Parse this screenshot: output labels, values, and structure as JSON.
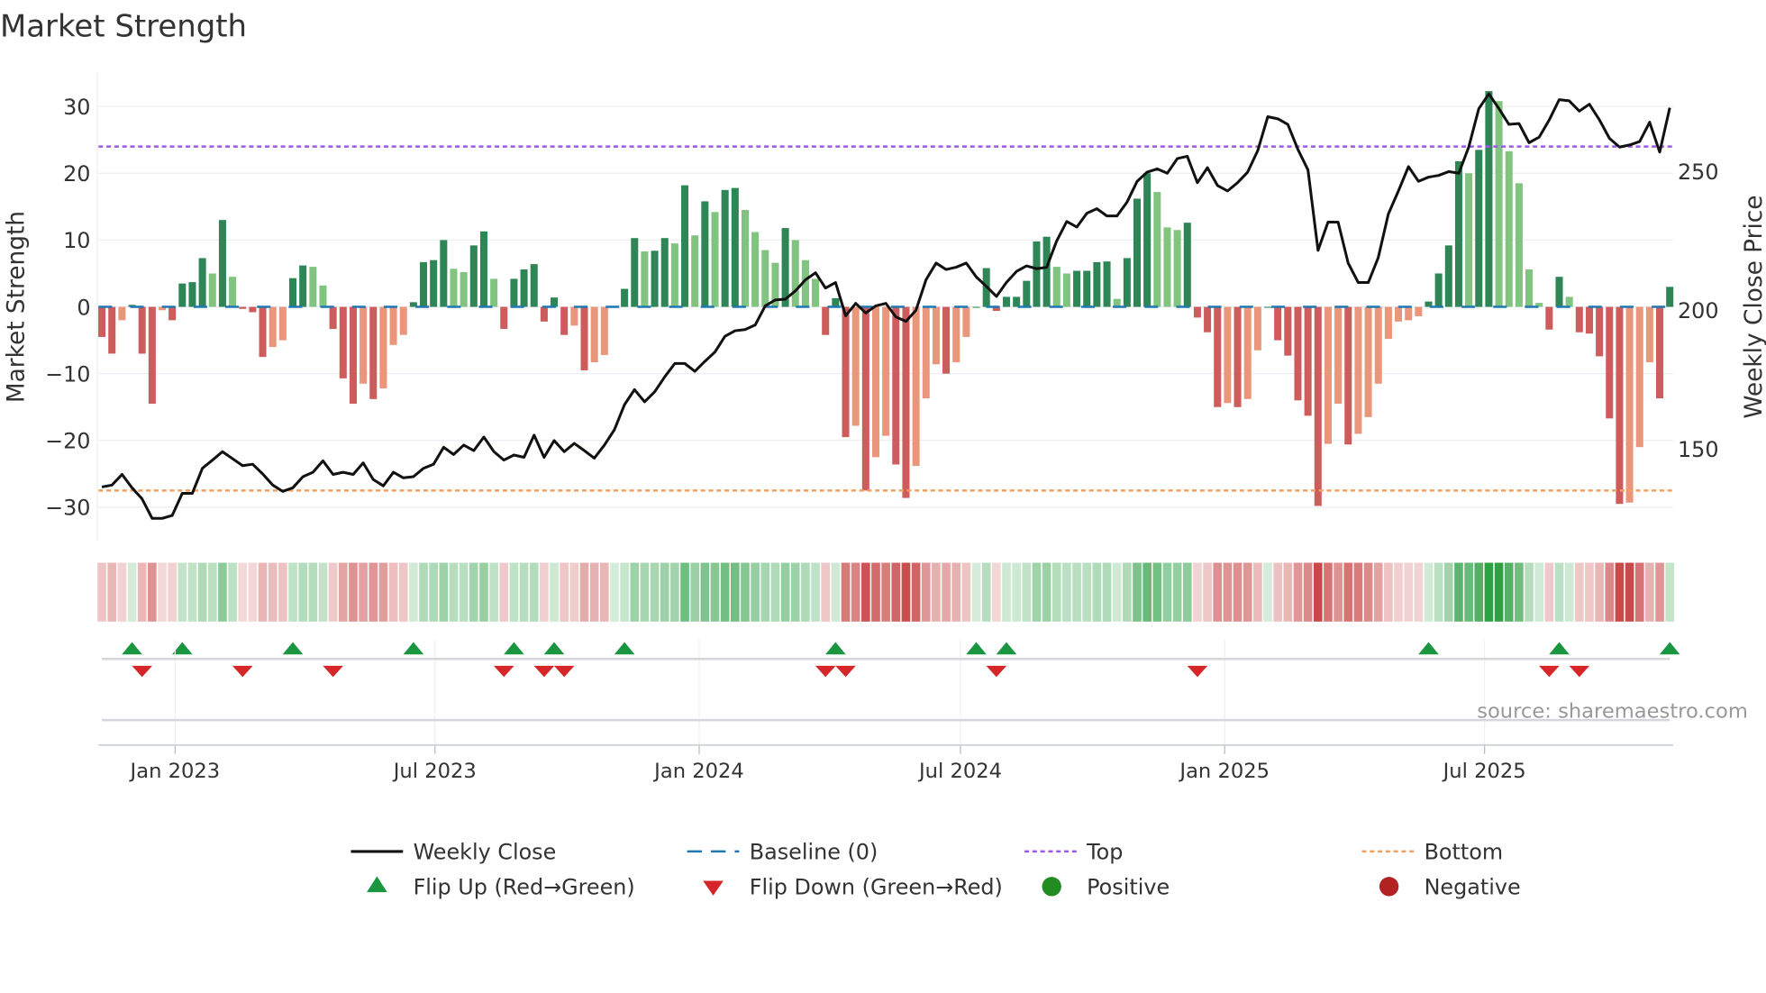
{
  "title": "Market Strength",
  "source": "source: sharemaestro.com",
  "chart_data": {
    "type": "bar",
    "title": "Market Strength",
    "ylabel": "Market Strength",
    "y2label": "Weekly Close Price",
    "ylim": [
      -35,
      35
    ],
    "y2lim": [
      116,
      289
    ],
    "yticks": [
      30,
      20,
      10,
      0,
      -10,
      -20,
      -30
    ],
    "ytick_labels": [
      "30",
      "20",
      "10",
      "0",
      "−10",
      "−20",
      "−30"
    ],
    "y2ticks": [
      250,
      200,
      150
    ],
    "y2tick_labels": [
      "250",
      "200",
      "150"
    ],
    "x_start": "2022-11-11",
    "x_step_days": 7,
    "xticks": [
      "2023-01-01",
      "2023-07-01",
      "2024-01-01",
      "2024-07-01",
      "2025-01-01",
      "2025-07-01"
    ],
    "xtick_labels": [
      "Jan 2023",
      "Jul 2023",
      "Jan 2024",
      "Jul 2024",
      "Jan 2025",
      "Jul 2025"
    ],
    "top_level": 24,
    "bottom_level": -27.5,
    "baseline": 0,
    "strength": [
      -4.5,
      -7,
      -2,
      0.3,
      -7,
      -14.5,
      -0.5,
      -2,
      3.5,
      3.7,
      7.3,
      5,
      13,
      4.5,
      -0.3,
      -0.8,
      -7.5,
      -6,
      -5,
      4.3,
      6.2,
      6,
      3.2,
      -3.3,
      -10.7,
      -14.5,
      -11.5,
      -13.8,
      -12.2,
      -5.7,
      -4.2,
      0.7,
      6.7,
      7,
      10,
      5.7,
      5.2,
      9.2,
      11.3,
      4.2,
      -3.3,
      4.2,
      5.6,
      6.4,
      -2.2,
      1.4,
      -4.2,
      -2.8,
      -9.5,
      -8.3,
      -7.2,
      0,
      2.7,
      10.3,
      8.3,
      8.4,
      10.3,
      9.5,
      18.2,
      10.7,
      15.8,
      14.2,
      17.5,
      17.8,
      14.5,
      11.2,
      8.5,
      6.6,
      11.8,
      10,
      7,
      4.2,
      -4.2,
      1.3,
      -19.5,
      -17.8,
      -27.5,
      -22.5,
      -19.3,
      -23.6,
      -28.6,
      -23.8,
      -13.7,
      -8.6,
      -10,
      -8.3,
      -4.5,
      0,
      5.8,
      -0.6,
      1.5,
      1.5,
      3.9,
      9.8,
      10.5,
      6,
      5,
      5.4,
      5.4,
      6.7,
      6.8,
      1.2,
      7.3,
      16.2,
      20,
      17.2,
      11.9,
      11.5,
      12.6,
      -1.6,
      -3.8,
      -15,
      -14.4,
      -15,
      -13.8,
      -6.5,
      0,
      -5,
      -7.3,
      -14,
      -16.3,
      -29.8,
      -20.5,
      -14.5,
      -20.6,
      -19,
      -16.5,
      -11.5,
      -4.8,
      -2.2,
      -2,
      -1.4,
      0.8,
      5,
      9.2,
      21.8,
      20,
      23.5,
      32.3,
      30.8,
      23.3,
      18.5,
      5.6,
      0.6,
      -3.4,
      4.5,
      1.5,
      -3.8,
      -4,
      -7.4,
      -16.7,
      -29.5,
      -29.3,
      -21,
      -8.3,
      -13.7,
      3
    ],
    "weekly_close": [
      136.3,
      137,
      140.8,
      136,
      132,
      125,
      125,
      126,
      134,
      134,
      143,
      146,
      149,
      146.5,
      144,
      144.5,
      141,
      137,
      134.7,
      136,
      140,
      141.6,
      145.7,
      140.8,
      141.6,
      140.8,
      145,
      139,
      136.7,
      141.6,
      139.6,
      140,
      143,
      144.5,
      150.6,
      148,
      151.4,
      149.4,
      154.3,
      149,
      146,
      147.8,
      147,
      155,
      147,
      153,
      149,
      152,
      149.4,
      146.7,
      151.4,
      157,
      166,
      171.4,
      167,
      170.6,
      176,
      180.8,
      180.8,
      178,
      181.6,
      185,
      190.6,
      192.6,
      193,
      194.7,
      201.6,
      203.7,
      204,
      207,
      211,
      213.5,
      208,
      210,
      198,
      202.5,
      199,
      201.6,
      202.5,
      197.6,
      196,
      200,
      211,
      217,
      214.7,
      215.5,
      217,
      212,
      208.6,
      205,
      210,
      214,
      216,
      215,
      215.5,
      225,
      232,
      230,
      235,
      236.6,
      234,
      234,
      239,
      246.5,
      249.8,
      251,
      249.4,
      254.7,
      255.5,
      246,
      251.4,
      245,
      243,
      246,
      249.8,
      257.5,
      269.8,
      269,
      267,
      258,
      250.6,
      221.6,
      231.8,
      231.8,
      217,
      210,
      210,
      219,
      234.7,
      243,
      251.8,
      246.5,
      248,
      248.6,
      250,
      249.4,
      258.8,
      272.7,
      278,
      272.7,
      267,
      267.3,
      260.4,
      262.4,
      268.6,
      275.9,
      275.5,
      271.8,
      274.3,
      268.6,
      262,
      258.8,
      259.6,
      260.8,
      267.8,
      257,
      273
    ],
    "flip_up_weeks": [
      3,
      8,
      19,
      31,
      41,
      45,
      52,
      73,
      87,
      90,
      132,
      145,
      156
    ],
    "flip_down_weeks": [
      4,
      14,
      23,
      40,
      44,
      46,
      72,
      74,
      89,
      109,
      144,
      147
    ],
    "legend_placement": "bottom-center",
    "legend": [
      {
        "label": "Weekly Close",
        "kind": "line",
        "color": "#111111"
      },
      {
        "label": "Baseline (0)",
        "kind": "dash",
        "color": "#1f77b4"
      },
      {
        "label": "Top",
        "kind": "dot",
        "color": "#9b59e8"
      },
      {
        "label": "Bottom",
        "kind": "dot",
        "color": "#f0a060"
      },
      {
        "label": "Flip Up (Red→Green)",
        "kind": "tri-up",
        "color": "#1a9641"
      },
      {
        "label": "Flip Down (Green→Red)",
        "kind": "tri-down",
        "color": "#d7262a"
      },
      {
        "label": "Positive",
        "kind": "circle",
        "color": "#228b22"
      },
      {
        "label": "Negative",
        "kind": "circle",
        "color": "#b22222"
      }
    ],
    "colors": {
      "green_dark": "#2e8555",
      "green_light": "#80c480",
      "red_dark": "#cd5c5c",
      "red_light": "#e9967a"
    }
  }
}
